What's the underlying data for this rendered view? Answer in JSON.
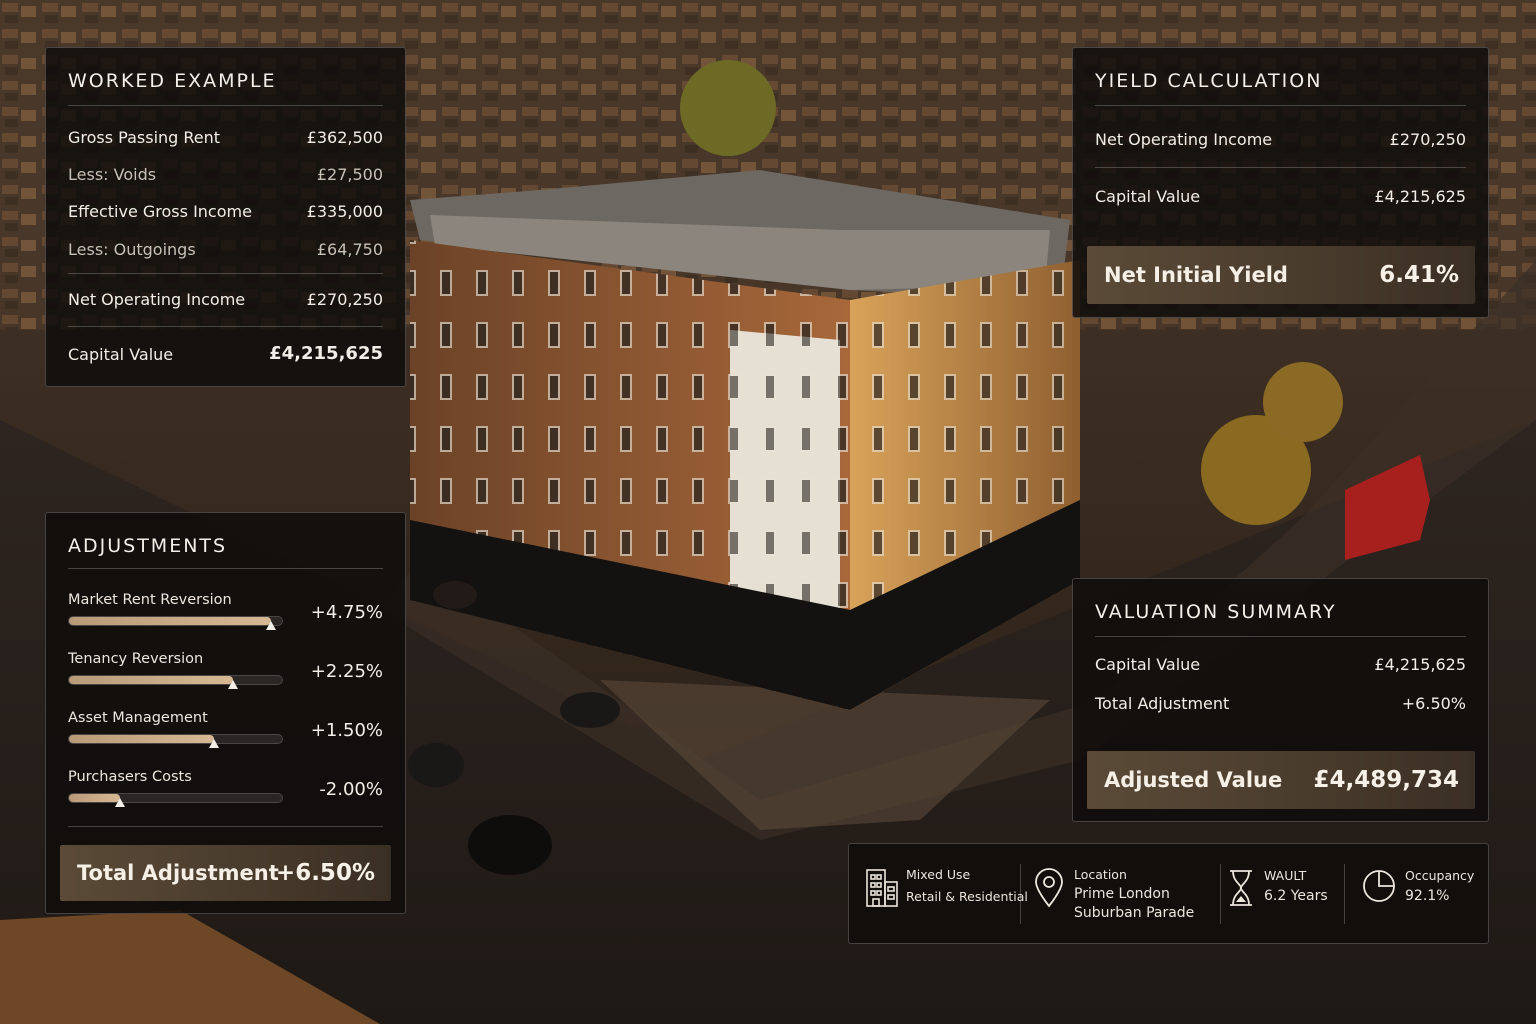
{
  "worked_example": {
    "title": "WORKED EXAMPLE",
    "rows": [
      {
        "label": "Gross Passing Rent",
        "value": "£362,500"
      },
      {
        "label": "Less: Voids",
        "value": "£27,500"
      },
      {
        "label": "Effective Gross Income",
        "value": "£335,000"
      },
      {
        "label": "Less: Outgoings",
        "value": "£64,750"
      },
      {
        "label": "Net Operating Income",
        "value": "£270,250"
      },
      {
        "label": "Capital Value",
        "value": "£4,215,625"
      }
    ]
  },
  "yield_calculation": {
    "title": "YIELD CALCULATION",
    "rows": [
      {
        "label": "Net Operating Income",
        "value": "£270,250"
      },
      {
        "label": "Capital Value",
        "value": "£4,215,625"
      }
    ],
    "highlight": {
      "label": "Net Initial Yield",
      "value": "6.41%"
    }
  },
  "adjustments": {
    "title": "ADJUSTMENTS",
    "items": [
      {
        "label": "Market Rent Reversion",
        "value": "+4.75%",
        "level": 0.95
      },
      {
        "label": "Tenancy Reversion",
        "value": "+2.25%",
        "level": 0.77
      },
      {
        "label": "Asset Management",
        "value": "+1.50%",
        "level": 0.68
      },
      {
        "label": "Purchasers Costs",
        "value": "-2.00%",
        "level": 0.24
      }
    ],
    "total": {
      "label": "Total Adjustment",
      "value": "+6.50%"
    }
  },
  "valuation_summary": {
    "title": "VALUATION SUMMARY",
    "rows": [
      {
        "label": "Capital Value",
        "value": "£4,215,625"
      },
      {
        "label": "Total Adjustment",
        "value": "+6.50%"
      }
    ],
    "highlight": {
      "label": "Adjusted Value",
      "value": "£4,489,734"
    }
  },
  "property_info": [
    {
      "icon": "building-icon",
      "line1": "Mixed Use",
      "line2": "Retail & Residential"
    },
    {
      "icon": "location-pin-icon",
      "line1": "Location",
      "line2": "Prime London",
      "line3": "Suburban Parade"
    },
    {
      "icon": "hourglass-icon",
      "line1": "WAULT",
      "line2": "6.2 Years"
    },
    {
      "icon": "pie-chart-icon",
      "line1": "Occupancy",
      "line2": "92.1%"
    }
  ],
  "colors": {
    "panel_bg": "#0e0c0b",
    "accent_bronze": "#b99a79",
    "highlight_bg": "#5a4a37",
    "text": "#f2ede6"
  }
}
